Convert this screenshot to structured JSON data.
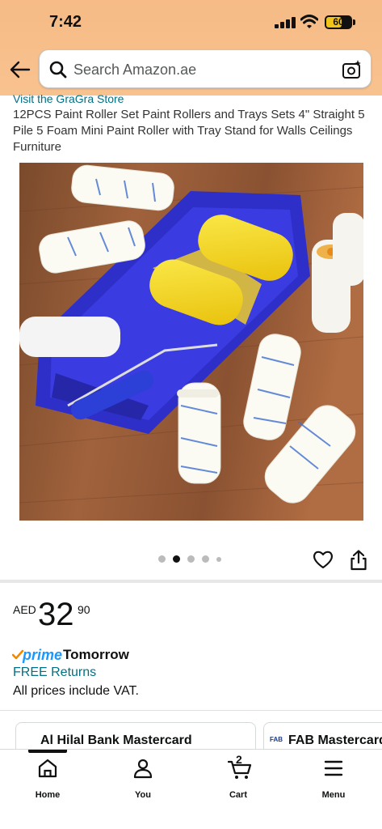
{
  "status_bar": {
    "time": "7:42",
    "battery": "60"
  },
  "search": {
    "placeholder": "Search Amazon.ae"
  },
  "product": {
    "store_link": "Visit the GraGra Store",
    "title": "12PCS Paint Roller Set Paint Rollers and Trays Sets 4\" Straight 5 Pile 5 Foam Mini Paint Roller with Tray Stand for Walls Ceilings Furniture",
    "image_count": 5,
    "active_image_index": 1
  },
  "price": {
    "currency": "AED",
    "whole": "32",
    "fraction": "90"
  },
  "delivery": {
    "prime_label": "prime",
    "day": "Tomorrow",
    "returns": "FREE Returns",
    "vat_note": "All prices include VAT."
  },
  "offers": [
    {
      "label": "Al Hilal Bank Mastercard"
    },
    {
      "logo": "FAB",
      "label": "FAB Mastercard"
    }
  ],
  "bottom_nav": [
    {
      "label": "Home",
      "icon": "home-icon"
    },
    {
      "label": "You",
      "icon": "user-icon"
    },
    {
      "label": "Cart",
      "icon": "cart-icon",
      "count": "2"
    },
    {
      "label": "Menu",
      "icon": "menu-icon"
    }
  ],
  "colors": {
    "header": "#f8bf8a",
    "link": "#007185",
    "prime": "#1a98ff",
    "tray_blue": "#2e2fc9",
    "roller_yellow": "#f7dc1e"
  }
}
